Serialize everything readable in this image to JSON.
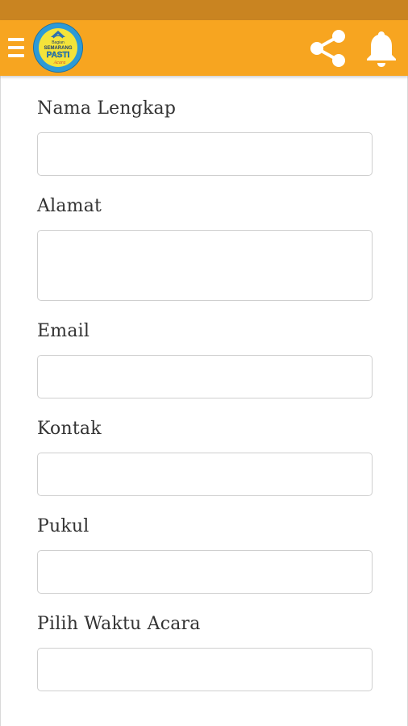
{
  "app_bar": {
    "menu_icon": "hamburger-menu-icon",
    "logo_text": {
      "top": "Bagian",
      "middle": "SEMARANG",
      "main": "PASTI",
      "bottom": "Acara"
    },
    "share_icon": "share-icon",
    "notification_icon": "bell-icon"
  },
  "form": {
    "nama_lengkap": {
      "label": "Nama Lengkap",
      "value": ""
    },
    "alamat": {
      "label": "Alamat",
      "value": ""
    },
    "email": {
      "label": "Email",
      "value": ""
    },
    "kontak": {
      "label": "Kontak",
      "value": ""
    },
    "pukul": {
      "label": "Pukul",
      "value": ""
    },
    "waktu_acara": {
      "label": "Pilih Waktu Acara",
      "value": ""
    }
  },
  "colors": {
    "status_bar": "#c98421",
    "app_bar": "#f7a520",
    "logo_blue": "#2d9ad6",
    "logo_yellow": "#f4e33a",
    "text": "#333333",
    "input_border": "#cfcfcf"
  }
}
